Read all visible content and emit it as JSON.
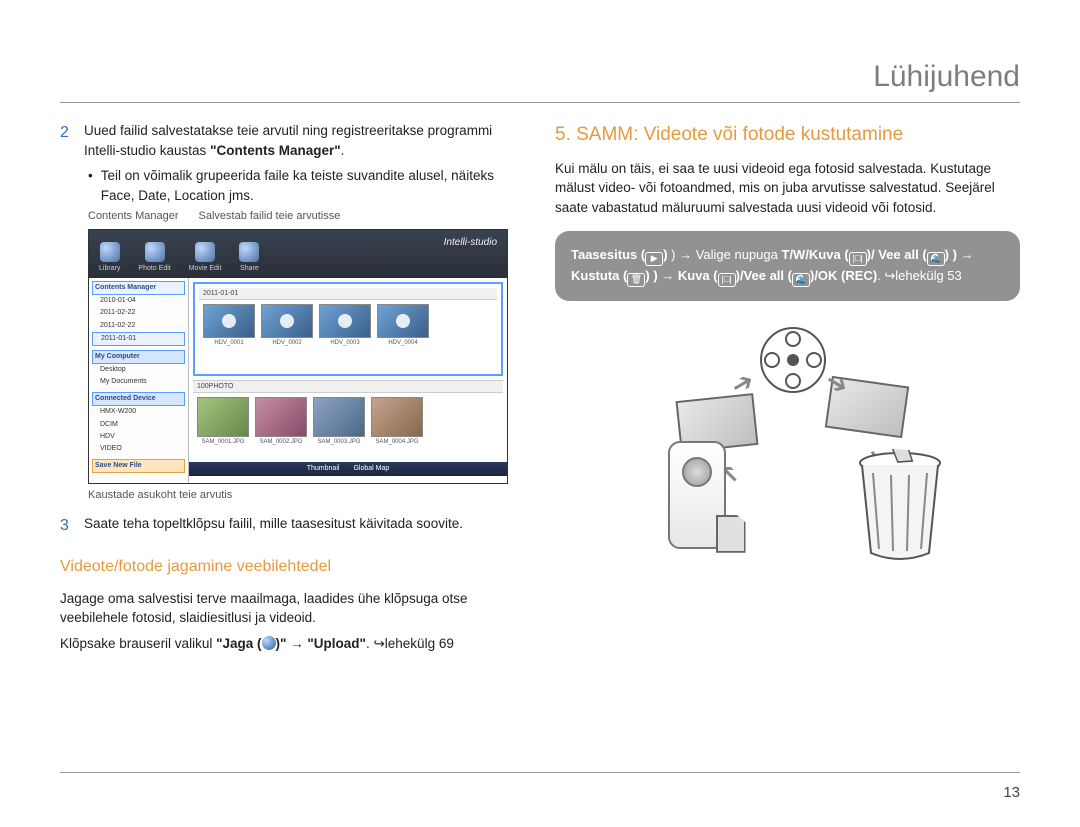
{
  "header": {
    "title": "Lühijuhend"
  },
  "left": {
    "step2_num": "2",
    "step2_text": "Uued failid salvestatakse teie arvutil ning registreeritakse programmi Intelli-studio kaustas ",
    "step2_bold": "\"Contents Manager\"",
    "step2_end": ".",
    "bullet1": "Teil on võimalik grupeerida faile ka teiste suvandite alusel, näiteks Face, Date, Location jms.",
    "cap_left": "Contents Manager",
    "cap_right": "Salvestab failid teie arvutisse",
    "cap_below": "Kaustade asukoht teie arvutis",
    "step3_num": "3",
    "step3_text": "Saate teha topeltklõpsu failil, mille taasesitust käivitada soovite.",
    "subhead": "Videote/fotode jagamine veebilehtedel",
    "share_p1": "Jagage oma salvestisi terve maailmaga, laadides ühe klõpsuga otse veebilehele fotosid, slaidiesitlusi ja videoid.",
    "share_p2_a": "Klõpsake brauseril valikul ",
    "share_p2_b": "\"Jaga (",
    "share_p2_c": ")\" ",
    "share_arrow": "→",
    "share_p2_d": " \"Upload\"",
    "share_p2_e": ". ↪lehekülg 69"
  },
  "right": {
    "step5_head": "5. SAMM: Videote või fotode kustutamine",
    "p1": "Kui mälu on täis, ei saa te uusi videoid ega fotosid salvestada. Kustutage mälust video- või fotoandmed, mis on juba arvutisse salvestatud. Seejärel saate vabastatud mäluruumi salvestada uusi videoid või fotosid.",
    "box_a": "Taasesitus (",
    "box_b": ") → Valige nupuga ",
    "box_c": "T/W/Kuva (",
    "box_d": ")/",
    "box_e": "Vee all (",
    "box_f": ") → Kustuta (",
    "box_g": ") → Kuva (",
    "box_h": ")/Vee all (",
    "box_i": ")/OK (REC)",
    "box_j": ". ↪lehekülg 53"
  },
  "app": {
    "logo": "Intelli-studio",
    "tb": [
      "Library",
      "Photo Edit",
      "Movie Edit",
      "Share"
    ],
    "side_heads": [
      "Contents Manager",
      "My Computer",
      "Connected Device"
    ],
    "side_items_cm": [
      "2010-01-04",
      "2011-02-22",
      "2011-02-22",
      "2011-01-01"
    ],
    "side_items_mc": [
      "Desktop",
      "My Documents"
    ],
    "side_items_cd": [
      "HMX-W200",
      "DCIM",
      "HDV",
      "VIDEO"
    ],
    "side_save": "Save New File",
    "date_bar": "2011-01-01",
    "vids": [
      "HDV_0001",
      "HDV_0002",
      "HDV_0003",
      "HDV_0004"
    ],
    "photo_folder": "100PHOTO",
    "photos": [
      "SAM_0001.JPG",
      "SAM_0002.JPG",
      "SAM_0003.JPG",
      "SAM_0004.JPG"
    ],
    "footer": [
      "Thumbnail",
      "Global Map"
    ]
  },
  "page_number": "13"
}
